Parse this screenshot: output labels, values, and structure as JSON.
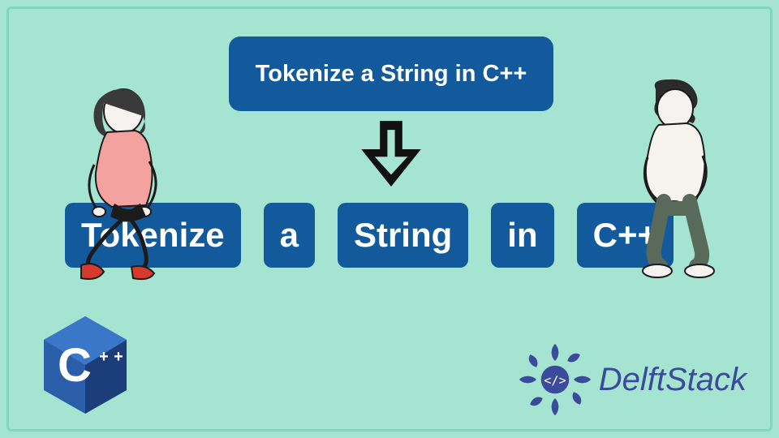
{
  "title": "Tokenize a String in C++",
  "tokens": [
    "Tokenize",
    "a",
    "String",
    "in",
    "C++"
  ],
  "brand": "DelftStack",
  "colors": {
    "bg": "#a5e4d0",
    "box": "#125a9c",
    "brand": "#3b4a9a"
  },
  "logo": {
    "language": "C++",
    "letter": "C",
    "plus": "+",
    "plus2": "+"
  }
}
